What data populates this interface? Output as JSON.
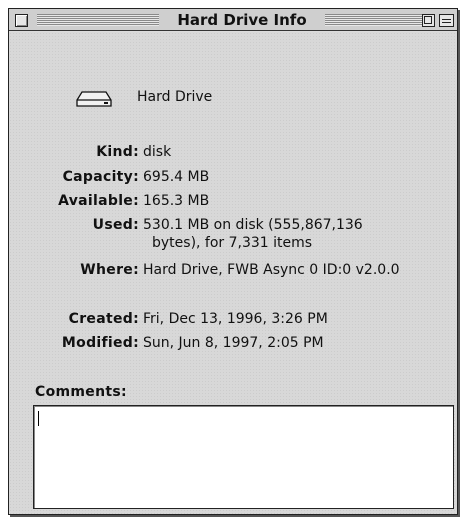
{
  "window": {
    "title": "Hard Drive Info"
  },
  "item": {
    "name": "Hard Drive",
    "icon": "hard-drive-icon"
  },
  "info": {
    "kind": {
      "label": "Kind:",
      "value": "disk"
    },
    "capacity": {
      "label": "Capacity:",
      "value": "695.4 MB"
    },
    "available": {
      "label": "Available:",
      "value": "165.3 MB"
    },
    "used": {
      "label": "Used:",
      "value_line1": "530.1 MB on disk (555,867,136",
      "value_line2": "bytes), for 7,331 items"
    },
    "where": {
      "label": "Where:",
      "value": "Hard Drive, FWB Async 0 ID:0 v2.0.0"
    },
    "created": {
      "label": "Created:",
      "value": "Fri, Dec 13, 1996, 3:26 PM"
    },
    "modified": {
      "label": "Modified:",
      "value": "Sun, Jun 8, 1997, 2:05 PM"
    }
  },
  "comments": {
    "label": "Comments:",
    "value": ""
  }
}
